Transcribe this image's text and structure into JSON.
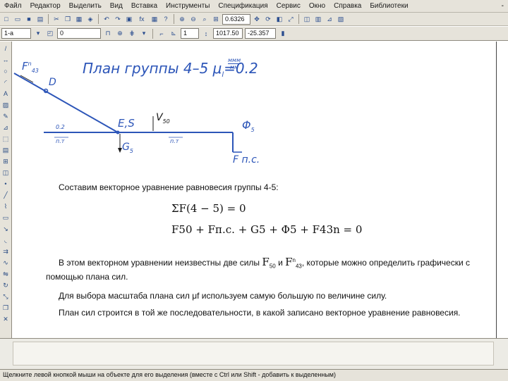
{
  "menu": {
    "items": [
      "Файл",
      "Редактор",
      "Выделить",
      "Вид",
      "Вставка",
      "Инструменты",
      "Спецификация",
      "Сервис",
      "Окно",
      "Справка",
      "Библиотеки"
    ],
    "control": "- "
  },
  "toolbar": {
    "zoom": "0.6326"
  },
  "toolbar2": {
    "style_value": "1-а",
    "layer_value": "0",
    "step_value": "1",
    "coord_x": "1017.50",
    "coord_y": "-25.357"
  },
  "drawing": {
    "title": "План группы 4–5 μ",
    "title_sub": "l",
    "title_eq": "=0.2",
    "title_unit_top": "ммм",
    "title_unit_bottom": "мм",
    "label_f43": "F",
    "label_f43_sup": "n",
    "label_f43_sub": "43",
    "label_d": "D",
    "label_es": "E,S",
    "label_phi": "Φ",
    "label_phi_sub": "5",
    "label_g": "G",
    "label_g_sub": "5",
    "label_fpc": "F п.с.",
    "label_v": "V",
    "label_v_sub": "50",
    "label_dim1": "0.2",
    "label_dim2": "п.т"
  },
  "text": {
    "line1": "Составим векторное уравнение равновесия группы 4-5:",
    "formula1": "ΣF(4 − 5) = 0",
    "formula2": "F50 + Fп.с. + G5 + Φ5 + F43n = 0",
    "line2_a": "В этом векторном уравнении неизвестны две силы",
    "line2_f50": "F",
    "line2_f50_sub": "50",
    "line2_and": "и",
    "line2_f43": "F",
    "line2_f43_sup": "n",
    "line2_f43_sub": "43",
    "line2_b": ", которые можно определить графически с",
    "line3": "помощью плана сил.",
    "line4": "Для выбора масштаба плана сил μf используем самую большую по величине силу.",
    "line5": "План сил строится в той же последовательности, в какой записано векторное уравнение равновесия."
  },
  "status": {
    "text": "Щелкните левой кнопкой мыши на объекте для его выделения (вместе с Ctrl или Shift - добавить к выделенным)"
  }
}
